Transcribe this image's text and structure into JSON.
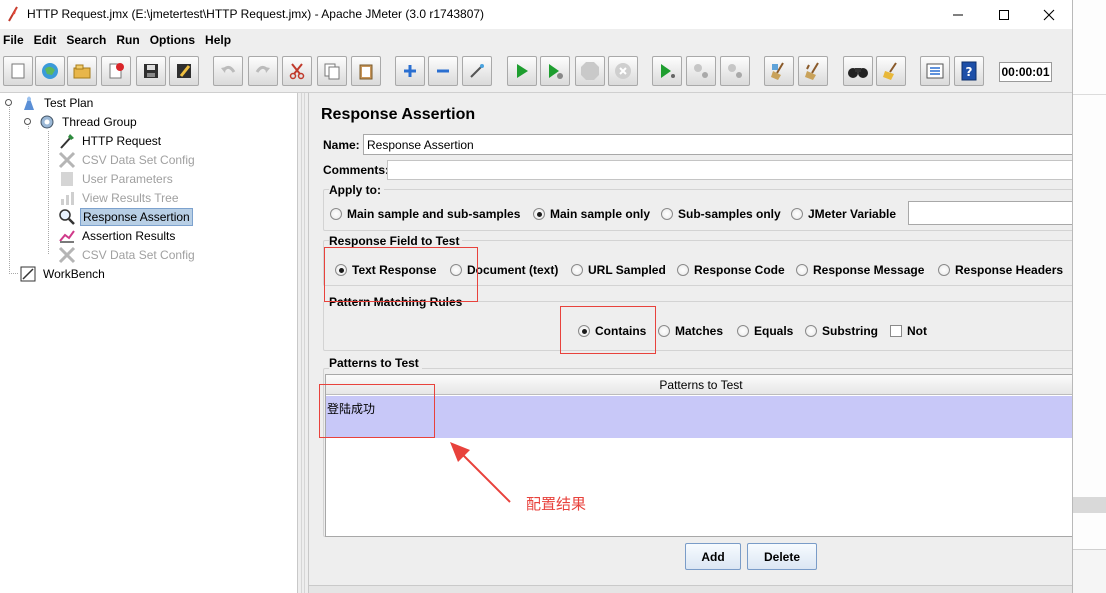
{
  "window": {
    "title": "HTTP Request.jmx (E:\\jmetertest\\HTTP Request.jmx) - Apache JMeter (3.0 r1743807)"
  },
  "menu": [
    "File",
    "Edit",
    "Search",
    "Run",
    "Options",
    "Help"
  ],
  "toolbar": {
    "icons": [
      "new-icon",
      "templates-icon",
      "open-icon",
      "close-icon",
      "save-icon",
      "save-as-icon",
      "undo-icon",
      "redo-icon",
      "cut-icon",
      "copy-icon",
      "paste-icon",
      "expand-icon",
      "collapse-icon",
      "toggle-icon",
      "start-icon",
      "start-no-pause-icon",
      "stop-icon",
      "shutdown-icon",
      "remote-start-icon",
      "remote-stop-icon",
      "remote-shutdown-icon",
      "clear-icon",
      "clear-all-icon",
      "search-icon",
      "reset-search-icon",
      "function-helper-icon",
      "help-icon"
    ],
    "elapsed": "00:00:01"
  },
  "tree": {
    "items": [
      {
        "label": "Test Plan",
        "icon": "test-plan-icon",
        "disabled": false,
        "selected": false
      },
      {
        "label": "Thread Group",
        "icon": "thread-group-icon",
        "disabled": false,
        "selected": false
      },
      {
        "label": "HTTP Request",
        "icon": "http-request-icon",
        "disabled": false,
        "selected": false
      },
      {
        "label": "CSV Data Set Config",
        "icon": "csv-config-icon",
        "disabled": true,
        "selected": false
      },
      {
        "label": "User Parameters",
        "icon": "user-parameters-icon",
        "disabled": true,
        "selected": false
      },
      {
        "label": "View Results Tree",
        "icon": "results-tree-icon",
        "disabled": true,
        "selected": false
      },
      {
        "label": "Response Assertion",
        "icon": "magnifier-icon",
        "disabled": false,
        "selected": true
      },
      {
        "label": "Assertion Results",
        "icon": "assertion-results-icon",
        "disabled": false,
        "selected": false
      },
      {
        "label": "CSV Data Set Config",
        "icon": "csv-config-icon",
        "disabled": true,
        "selected": false
      },
      {
        "label": "WorkBench",
        "icon": "workbench-icon",
        "disabled": false,
        "selected": false
      }
    ]
  },
  "panel": {
    "title": "Response Assertion",
    "name_label": "Name:",
    "name_value": "Response Assertion",
    "comments_label": "Comments:",
    "comments_value": "",
    "apply_to": {
      "title": "Apply to:",
      "options": [
        "Main sample and sub-samples",
        "Main sample only",
        "Sub-samples only",
        "JMeter Variable"
      ],
      "selected": 1,
      "variable_value": ""
    },
    "response_field": {
      "title": "Response Field to Test",
      "options": [
        "Text Response",
        "Document (text)",
        "URL Sampled",
        "Response Code",
        "Response Message",
        "Response Headers"
      ],
      "selected": 0
    },
    "pattern_rules": {
      "title": "Pattern Matching Rules",
      "options": [
        "Contains",
        "Matches",
        "Equals",
        "Substring"
      ],
      "selected": 0,
      "not_label": "Not",
      "not_checked": false
    },
    "patterns": {
      "title": "Patterns to Test",
      "column_header": "Patterns to Test",
      "rows": [
        "登陆成功"
      ]
    },
    "add_label": "Add",
    "delete_label": "Delete"
  },
  "annotation": {
    "text": "配置结果",
    "color": "#e8423c"
  }
}
